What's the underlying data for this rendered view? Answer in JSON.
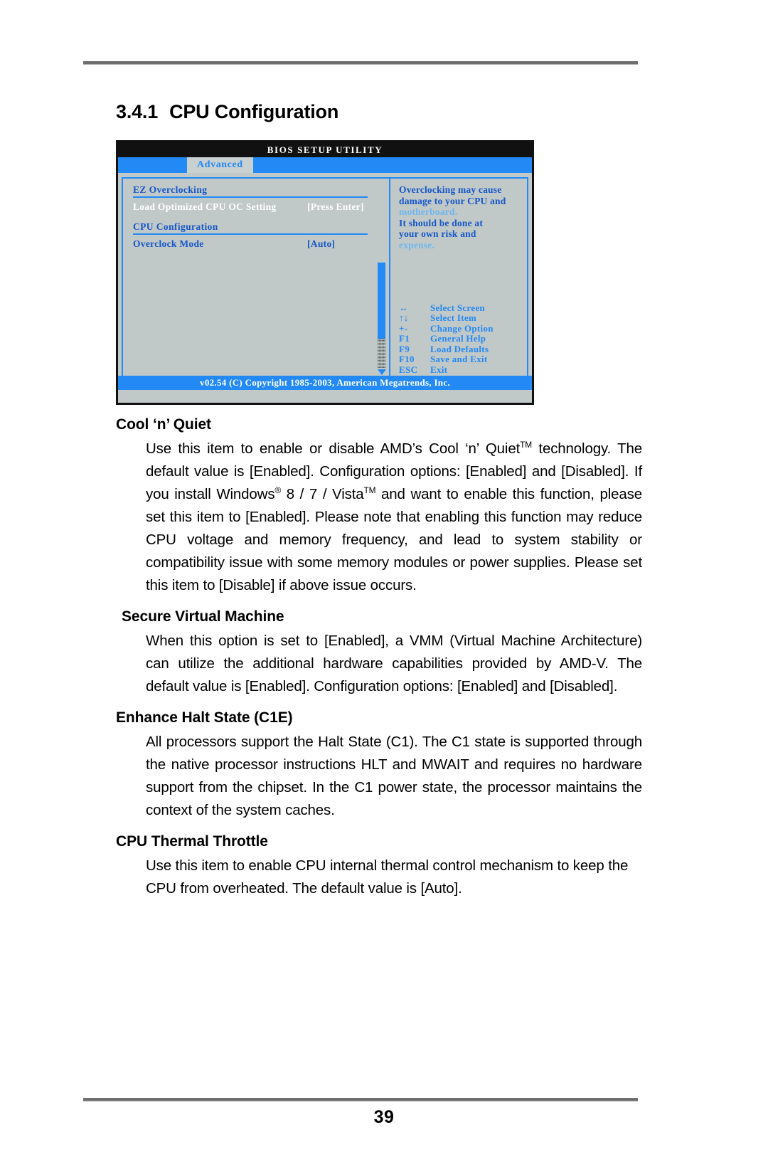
{
  "page": {
    "number": "39"
  },
  "heading": {
    "number": "3.4.1",
    "title": "CPU Configuration"
  },
  "bios": {
    "title": "BIOS SETUP UTILITY",
    "active_tab": "Advanced",
    "groups": [
      {
        "title": "EZ Overclocking",
        "items": [
          {
            "label": "Load Optimized CPU OC Setting",
            "value": "[Press Enter]",
            "selected": true
          }
        ]
      },
      {
        "title": "CPU Configuration",
        "items": [
          {
            "label": "Overclock Mode",
            "value": "[Auto]",
            "selected": false
          }
        ]
      }
    ],
    "help": {
      "line1": "Overclocking may cause",
      "line2": "damage to your CPU and",
      "line3": "motherboard.",
      "line4": "It should be done at",
      "line5": "your own risk and",
      "line6": "expense."
    },
    "keys": [
      {
        "key": "↔",
        "action": "Select Screen"
      },
      {
        "key": "↑↓",
        "action": "Select Item"
      },
      {
        "key": "+-",
        "action": "Change Option"
      },
      {
        "key": "F1",
        "action": "General Help"
      },
      {
        "key": "F9",
        "action": "Load Defaults"
      },
      {
        "key": "F10",
        "action": "Save and Exit"
      },
      {
        "key": "ESC",
        "action": "Exit"
      }
    ],
    "footer": "v02.54 (C) Copyright 1985-2003, American Megatrends, Inc.",
    "colors": {
      "accent_blue": "#2389f5",
      "text_blue": "#1657c8",
      "panel_gray": "#c0c8c8",
      "titlebar_black": "#111111"
    }
  },
  "sections": [
    {
      "term": "Cool ‘n’ Quiet",
      "paragraphs": [
        "Use this item to enable or disable AMD’s Cool ‘n’ Quiet|TM| technology. The default value is [Enabled]. Configuration options: [Enabled] and [Disabled]. If you install Windows|R| 8 / 7 / Vista|TM| and want to enable this function, please set this item to [Enabled]. Please note that enabling this function may reduce CPU voltage and memory frequency, and lead to system stability or compatibility issue with some memory modules or power supplies. Please set this item to [Disable] if above issue occurs."
      ]
    },
    {
      "term": "Secure Virtual Machine",
      "paragraphs": [
        " When this option is set to [Enabled], a VMM (Virtual Machine Architecture) can utilize the additional hardware capabilities provided by AMD-V. The default value is [Enabled]. Configuration options: [Enabled] and [Disabled]."
      ]
    },
    {
      "term": "Enhance Halt State (C1E)",
      "paragraphs": [
        "All processors support the Halt State (C1). The C1 state is supported through the native processor instructions HLT and MWAIT and requires no hardware support from the chipset. In the C1 power state, the processor maintains the context of the system caches."
      ]
    },
    {
      "term": "CPU Thermal Throttle",
      "paragraphs": [
        "Use this item to enable CPU internal thermal control mechanism to keep the CPU from overheated. The default value is [Auto]."
      ]
    }
  ]
}
